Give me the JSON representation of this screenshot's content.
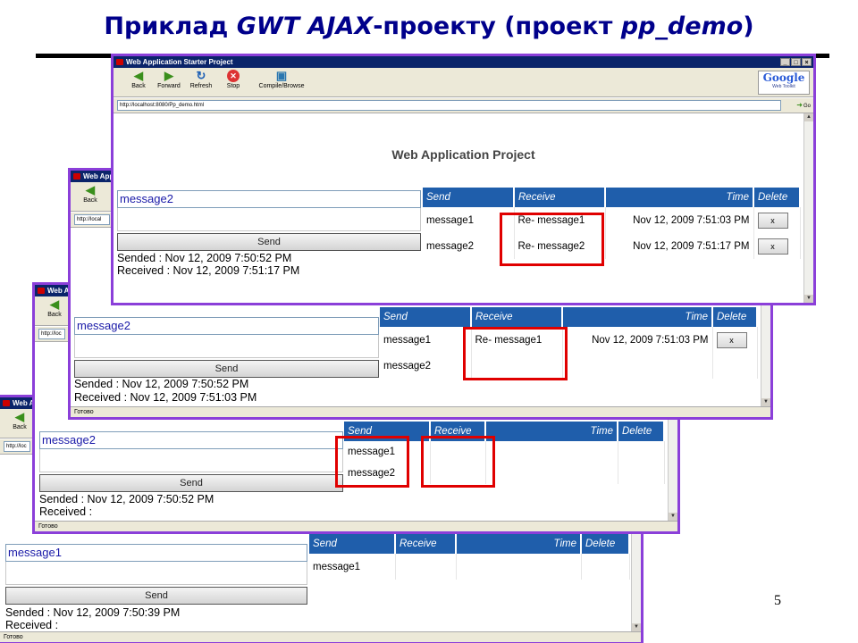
{
  "slide": {
    "title_part1": "Приклад ",
    "title_em1": "GWT AJAX",
    "title_part2": "-проекту (проект ",
    "title_em2": "pp_demo",
    "title_part3": ")",
    "page_number": "5"
  },
  "browser": {
    "window_title": "Web Application Starter Project",
    "toolbar": {
      "back": "Back",
      "forward": "Forward",
      "refresh": "Refresh",
      "stop": "Stop",
      "compile": "Compile/Browse"
    },
    "logo_text": "Google",
    "logo_sub": "Web Toolkit",
    "address": "http://localhost:8080/Pp_demo.html",
    "address_short": "http://loc",
    "address_short2": "http://local",
    "go_label": "Go",
    "status_text": "Готово"
  },
  "app": {
    "heading": "Web Application Project",
    "send_button": "Send",
    "delete_button": "x",
    "columns": {
      "send": "Send",
      "receive": "Receive",
      "time": "Time",
      "delete": "Delete"
    }
  },
  "windows": [
    {
      "name": "step-4",
      "message_input": "message2",
      "sended": "Sended : Nov 12, 2009 7:50:52 PM",
      "received": "Received : Nov 12, 2009 7:51:17 PM",
      "rows": [
        {
          "send": "message1",
          "receive": "Re- message1",
          "time": "Nov 12, 2009 7:51:03 PM"
        },
        {
          "send": "message2",
          "receive": "Re- message2",
          "time": "Nov 12, 2009 7:51:17 PM"
        }
      ]
    },
    {
      "name": "step-3",
      "message_input": "message2",
      "sended": "Sended : Nov 12, 2009 7:50:52 PM",
      "received": "Received : Nov 12, 2009 7:51:03 PM",
      "rows": [
        {
          "send": "message1",
          "receive": "Re- message1",
          "time": "Nov 12, 2009 7:51:03 PM"
        },
        {
          "send": "message2",
          "receive": "",
          "time": ""
        }
      ]
    },
    {
      "name": "step-2",
      "message_input": "message2",
      "sended": "Sended : Nov 12, 2009 7:50:52 PM",
      "received": "Received :",
      "rows": [
        {
          "send": "message1",
          "receive": "",
          "time": ""
        },
        {
          "send": "message2",
          "receive": "",
          "time": ""
        }
      ]
    },
    {
      "name": "step-1",
      "message_input": "message1",
      "sended": "Sended : Nov 12, 2009 7:50:39 PM",
      "received": "Received :",
      "rows": [
        {
          "send": "message1",
          "receive": "",
          "time": ""
        }
      ]
    }
  ],
  "colors": {
    "frame": "#8b3fd9",
    "highlight": "#e00000",
    "table_header": "#1f5eab",
    "title": "#00008b"
  }
}
